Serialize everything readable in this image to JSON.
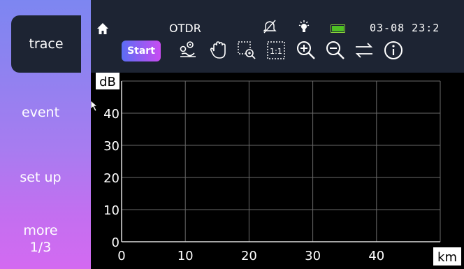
{
  "sidebar": {
    "items": [
      {
        "label": "trace"
      },
      {
        "label": "event"
      },
      {
        "label": "set up"
      },
      {
        "label_line1": "more",
        "label_line2": "1/3"
      }
    ],
    "gradient_top": "#7d86f1",
    "gradient_bottom": "#d36af1"
  },
  "header": {
    "title": "OTDR",
    "clock": "03-08 23:2",
    "start_label": "Start",
    "icons": [
      "home-icon",
      "mute-icon",
      "bulb-icon",
      "battery-icon"
    ],
    "toolbar_icons": [
      "marker-icon",
      "hand-icon",
      "zoom-area-icon",
      "one-to-one-icon",
      "zoom-in-icon",
      "zoom-out-icon",
      "swap-icon",
      "info-icon"
    ],
    "one_to_one_label": "1:1",
    "accent": "#4ec023"
  },
  "chart_data": {
    "type": "line",
    "xlabel": "km",
    "ylabel": "dB",
    "xlim": [
      0,
      50
    ],
    "ylim": [
      0,
      50
    ],
    "xticks": [
      0,
      10,
      20,
      30,
      40
    ],
    "yticks": [
      0,
      10,
      20,
      30,
      40
    ],
    "grid": true,
    "series": []
  }
}
